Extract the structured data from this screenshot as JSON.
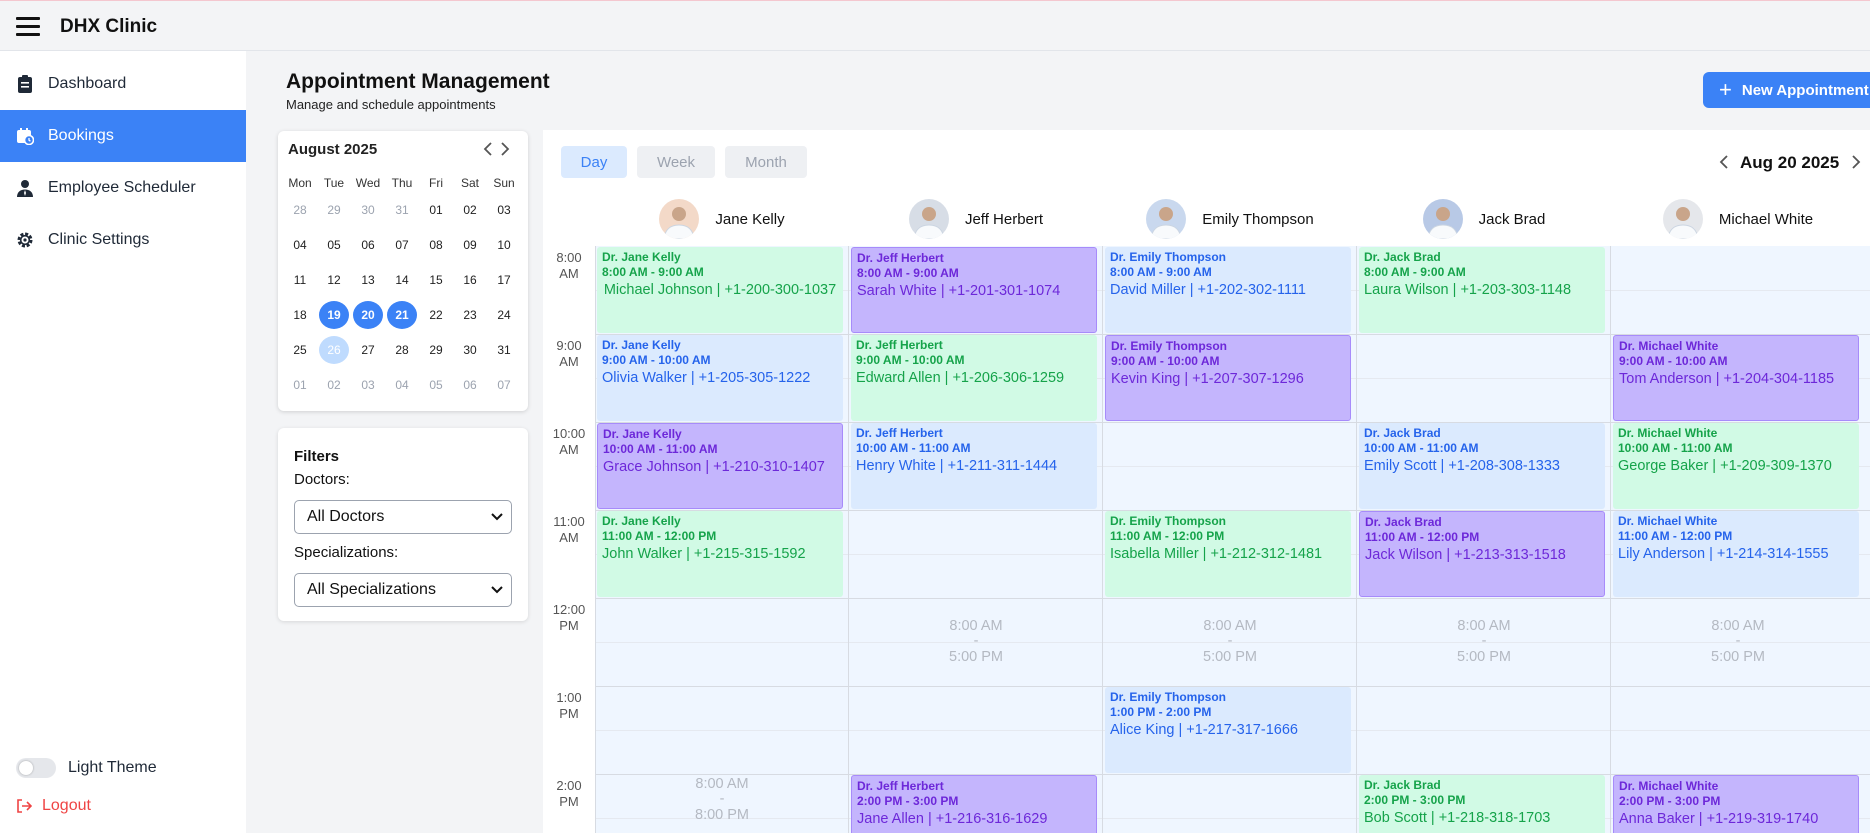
{
  "app": {
    "title": "DHX Clinic"
  },
  "sidebar": {
    "items": [
      {
        "label": "Dashboard",
        "icon": "clipboard-icon"
      },
      {
        "label": "Bookings",
        "icon": "calendar-clock-icon"
      },
      {
        "label": "Employee Scheduler",
        "icon": "user-tie-icon"
      },
      {
        "label": "Clinic Settings",
        "icon": "gear-icon"
      }
    ],
    "active_index": 1,
    "theme_label": "Light Theme",
    "logout_label": "Logout"
  },
  "header": {
    "title": "Appointment Management",
    "subtitle": "Manage and schedule appointments",
    "new_button": "New Appointment"
  },
  "mini_calendar": {
    "month_label": "August 2025",
    "weekdays": [
      "Mon",
      "Tue",
      "Wed",
      "Thu",
      "Fri",
      "Sat",
      "Sun"
    ],
    "weeks": [
      [
        "28",
        "29",
        "30",
        "31",
        "01",
        "02",
        "03"
      ],
      [
        "04",
        "05",
        "06",
        "07",
        "08",
        "09",
        "10"
      ],
      [
        "11",
        "12",
        "13",
        "14",
        "15",
        "16",
        "17"
      ],
      [
        "18",
        "19",
        "20",
        "21",
        "22",
        "23",
        "24"
      ],
      [
        "25",
        "26",
        "27",
        "28",
        "29",
        "30",
        "31"
      ],
      [
        "01",
        "02",
        "03",
        "04",
        "05",
        "06",
        "07"
      ]
    ],
    "selected_days": [
      "19",
      "20",
      "21"
    ],
    "today": "26"
  },
  "filters": {
    "title": "Filters",
    "doctors_label": "Doctors:",
    "doctors_value": "All Doctors",
    "specializations_label": "Specializations:",
    "specializations_value": "All Specializations"
  },
  "scheduler": {
    "views": [
      "Day",
      "Week",
      "Month"
    ],
    "active_view": "Day",
    "date_label": "Aug 20 2025",
    "time_labels": [
      [
        "8:00",
        "AM"
      ],
      [
        "9:00",
        "AM"
      ],
      [
        "10:00",
        "AM"
      ],
      [
        "11:00",
        "AM"
      ],
      [
        "12:00",
        "PM"
      ],
      [
        "1:00",
        "PM"
      ],
      [
        "2:00",
        "PM"
      ]
    ],
    "doctors": [
      {
        "name": "Jane Kelly",
        "avatar_color": "#f3d9c8"
      },
      {
        "name": "Jeff Herbert",
        "avatar_color": "#d7dde6"
      },
      {
        "name": "Emily Thompson",
        "avatar_color": "#c9d8ee"
      },
      {
        "name": "Jack Brad",
        "avatar_color": "#b8c9e6"
      },
      {
        "name": "Michael White",
        "avatar_color": "#e5e7eb"
      }
    ],
    "events": [
      {
        "col": 0,
        "start": 0,
        "dur": 1,
        "color": "green",
        "doctor": "Dr. Jane Kelly",
        "time": "8:00 AM - 9:00 AM",
        "text": "Michael Johnson | +1-200-300-1037",
        "center": true
      },
      {
        "col": 0,
        "start": 1,
        "dur": 1,
        "color": "blue",
        "doctor": "Dr. Jane Kelly",
        "time": "9:00 AM - 10:00 AM",
        "text": "Olivia Walker | +1-205-305-1222"
      },
      {
        "col": 0,
        "start": 2,
        "dur": 1,
        "color": "purple",
        "doctor": "Dr. Jane Kelly",
        "time": "10:00 AM - 11:00 AM",
        "text": "Grace Johnson | +1-210-310-1407"
      },
      {
        "col": 0,
        "start": 3,
        "dur": 1,
        "color": "green",
        "doctor": "Dr. Jane Kelly",
        "time": "11:00 AM - 12:00 PM",
        "text": "John Walker | +1-215-315-1592"
      },
      {
        "col": 1,
        "start": 0,
        "dur": 1,
        "color": "purple",
        "doctor": "Dr. Jeff Herbert",
        "time": "8:00 AM - 9:00 AM",
        "text": "Sarah White | +1-201-301-1074"
      },
      {
        "col": 1,
        "start": 1,
        "dur": 1,
        "color": "green",
        "doctor": "Dr. Jeff Herbert",
        "time": "9:00 AM - 10:00 AM",
        "text": "Edward Allen | +1-206-306-1259"
      },
      {
        "col": 1,
        "start": 2,
        "dur": 1,
        "color": "blue",
        "doctor": "Dr. Jeff Herbert",
        "time": "10:00 AM - 11:00 AM",
        "text": "Henry White | +1-211-311-1444"
      },
      {
        "col": 1,
        "start": 6,
        "dur": 1,
        "color": "purple",
        "doctor": "Dr. Jeff Herbert",
        "time": "2:00 PM - 3:00 PM",
        "text": "Jane Allen | +1-216-316-1629"
      },
      {
        "col": 2,
        "start": 0,
        "dur": 1,
        "color": "blue",
        "doctor": "Dr. Emily Thompson",
        "time": "8:00 AM - 9:00 AM",
        "text": "David Miller | +1-202-302-1111"
      },
      {
        "col": 2,
        "start": 1,
        "dur": 1,
        "color": "purple",
        "doctor": "Dr. Emily Thompson",
        "time": "9:00 AM - 10:00 AM",
        "text": "Kevin King | +1-207-307-1296"
      },
      {
        "col": 2,
        "start": 3,
        "dur": 1,
        "color": "green",
        "doctor": "Dr. Emily Thompson",
        "time": "11:00 AM - 12:00 PM",
        "text": "Isabella Miller | +1-212-312-1481"
      },
      {
        "col": 2,
        "start": 5,
        "dur": 1,
        "color": "blue",
        "doctor": "Dr. Emily Thompson",
        "time": "1:00 PM - 2:00 PM",
        "text": "Alice King | +1-217-317-1666"
      },
      {
        "col": 3,
        "start": 0,
        "dur": 1,
        "color": "green",
        "doctor": "Dr. Jack Brad",
        "time": "8:00 AM - 9:00 AM",
        "text": "Laura Wilson | +1-203-303-1148"
      },
      {
        "col": 3,
        "start": 2,
        "dur": 1,
        "color": "blue",
        "doctor": "Dr. Jack Brad",
        "time": "10:00 AM - 11:00 AM",
        "text": "Emily Scott | +1-208-308-1333"
      },
      {
        "col": 3,
        "start": 3,
        "dur": 1,
        "color": "purple",
        "doctor": "Dr. Jack Brad",
        "time": "11:00 AM - 12:00 PM",
        "text": "Jack Wilson | +1-213-313-1518"
      },
      {
        "col": 3,
        "start": 6,
        "dur": 1,
        "color": "green",
        "doctor": "Dr. Jack Brad",
        "time": "2:00 PM - 3:00 PM",
        "text": "Bob Scott | +1-218-318-1703"
      },
      {
        "col": 4,
        "start": 1,
        "dur": 1,
        "color": "purple",
        "doctor": "Dr. Michael White",
        "time": "9:00 AM - 10:00 AM",
        "text": "Tom Anderson | +1-204-304-1185"
      },
      {
        "col": 4,
        "start": 2,
        "dur": 1,
        "color": "green",
        "doctor": "Dr. Michael White",
        "time": "10:00 AM - 11:00 AM",
        "text": "George Baker | +1-209-309-1370"
      },
      {
        "col": 4,
        "start": 3,
        "dur": 1,
        "color": "blue",
        "doctor": "Dr. Michael White",
        "time": "11:00 AM - 12:00 PM",
        "text": "Lily Anderson | +1-214-314-1555"
      },
      {
        "col": 4,
        "start": 6,
        "dur": 1,
        "color": "purple",
        "doctor": "Dr. Michael White",
        "time": "2:00 PM - 3:00 PM",
        "text": "Anna Baker | +1-219-319-1740"
      }
    ],
    "breaks": [
      {
        "col": 1,
        "slot": 4,
        "from": "8:00 AM",
        "to": "5:00 PM"
      },
      {
        "col": 2,
        "slot": 4,
        "from": "8:00 AM",
        "to": "5:00 PM"
      },
      {
        "col": 3,
        "slot": 4,
        "from": "8:00 AM",
        "to": "5:00 PM"
      },
      {
        "col": 4,
        "slot": 4,
        "from": "8:00 AM",
        "to": "5:00 PM"
      },
      {
        "col": 0,
        "slot": 5.8,
        "from": "8:00 AM",
        "to": "8:00 PM"
      }
    ],
    "colors": {
      "green": "#d1fae5",
      "purple": "#c4b5fd",
      "blue": "#dbeafe",
      "accent": "#3b82f6"
    }
  }
}
